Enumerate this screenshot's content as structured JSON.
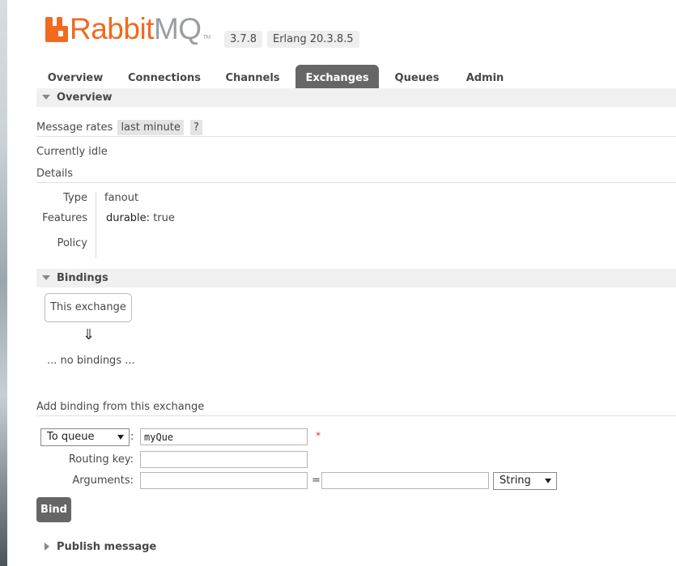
{
  "header": {
    "logo_rabbit": "Rabbit",
    "logo_mq": "MQ",
    "logo_tm": "TM",
    "version": "3.7.8",
    "erlang": "Erlang 20.3.8.5"
  },
  "tabs": [
    {
      "label": "Overview"
    },
    {
      "label": "Connections"
    },
    {
      "label": "Channels"
    },
    {
      "label": "Exchanges",
      "active": true
    },
    {
      "label": "Queues"
    },
    {
      "label": "Admin"
    }
  ],
  "overview": {
    "title": "Overview",
    "message_rates_label": "Message rates",
    "rate_period": "last minute",
    "help": "?",
    "status": "Currently idle",
    "details_label": "Details",
    "type_label": "Type",
    "type_value": "fanout",
    "features_label": "Features",
    "features_key": "durable:",
    "features_value": "true",
    "policy_label": "Policy"
  },
  "bindings": {
    "title": "Bindings",
    "this_exchange": "This exchange",
    "arrow": "⇓",
    "no_bindings": "... no bindings ..."
  },
  "add_binding": {
    "title": "Add binding from this exchange",
    "destination_type": "To queue",
    "colon": ":",
    "destination_value": "myQue",
    "required_marker": "*",
    "routing_key_label": "Routing key:",
    "routing_key_value": "",
    "arguments_label": "Arguments:",
    "arg_key": "",
    "equals": "=",
    "arg_value": "",
    "arg_type": "String",
    "bind_button": "Bind"
  },
  "publish": {
    "title": "Publish message"
  },
  "colors": {
    "brand_orange": "#f06a20",
    "tab_active_bg": "#666666",
    "section_bg": "#f0f0f0"
  }
}
